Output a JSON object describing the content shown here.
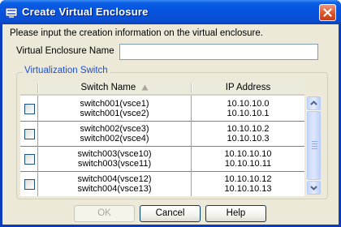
{
  "window": {
    "title": "Create Virtual Enclosure",
    "title_icon": "enclosure-icon",
    "close_icon": "close-icon"
  },
  "form": {
    "instruction": "Please input the creation information on the virtual enclosure.",
    "name_label": "Virtual Enclosure Name",
    "name_value": "",
    "name_placeholder": ""
  },
  "switch_group": {
    "legend": "Virtualization Switch",
    "columns": [
      "Switch Name",
      "IP Address"
    ],
    "sort": {
      "column": "Switch Name",
      "direction": "ascending",
      "icon": "sort-up-icon"
    },
    "rows": [
      {
        "checked": false,
        "names": [
          "switch001(vsce1)",
          "switch001(vsce2)"
        ],
        "ips": [
          "10.10.10.0",
          "10.10.10.1"
        ]
      },
      {
        "checked": false,
        "names": [
          "switch002(vsce3)",
          "switch002(vsce4)"
        ],
        "ips": [
          "10.10.10.2",
          "10.10.10.3"
        ]
      },
      {
        "checked": false,
        "names": [
          "switch003(vsce10)",
          "switch003(vsce11)"
        ],
        "ips": [
          "10.10.10.10",
          "10.10.10.11"
        ]
      },
      {
        "checked": false,
        "names": [
          "switch004(vsce12)",
          "switch004(vsce13)"
        ],
        "ips": [
          "10.10.10.12",
          "10.10.10.13"
        ]
      }
    ]
  },
  "buttons": {
    "ok": "OK",
    "ok_enabled": false,
    "cancel": "Cancel",
    "help": "Help"
  },
  "colors": {
    "titlebar": "#0553de",
    "dialog_bg": "#ece9d8",
    "group_legend": "#1f4fd1"
  }
}
